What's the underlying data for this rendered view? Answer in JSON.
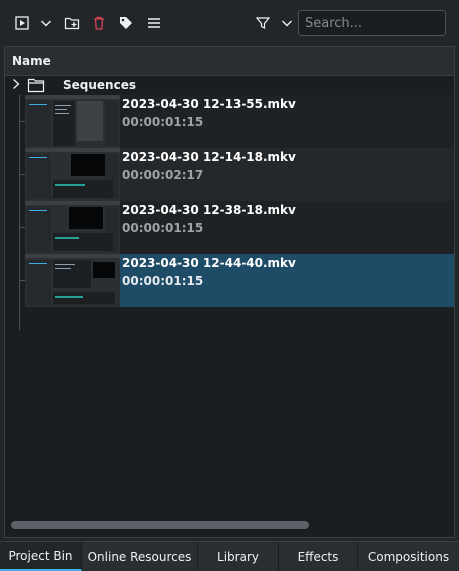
{
  "toolbar": {
    "icons": [
      "add-clip-icon",
      "chevron-down-icon",
      "new-folder-icon",
      "delete-icon",
      "tag-icon",
      "menu-icon",
      "filter-icon",
      "chevron-down-icon"
    ],
    "search_placeholder": "Search..."
  },
  "columns": {
    "name_header": "Name"
  },
  "tree": {
    "folder": {
      "label": "Sequences"
    },
    "clips": [
      {
        "name": "2023-04-30 12-13-55.mkv",
        "duration": "00:00:01:15",
        "selected": false
      },
      {
        "name": "2023-04-30 12-14-18.mkv",
        "duration": "00:00:02:17",
        "selected": false
      },
      {
        "name": "2023-04-30 12-38-18.mkv",
        "duration": "00:00:01:15",
        "selected": false
      },
      {
        "name": "2023-04-30 12-44-40.mkv",
        "duration": "00:00:01:15",
        "selected": true
      }
    ]
  },
  "tabs": [
    {
      "label": "Project Bin",
      "active": true
    },
    {
      "label": "Online Resources",
      "active": false
    },
    {
      "label": "Library",
      "active": false
    },
    {
      "label": "Effects",
      "active": false
    },
    {
      "label": "Compositions",
      "active": false
    }
  ],
  "colors": {
    "background": "#232629",
    "panel": "#1b1e20",
    "selection": "#1e4b66",
    "accent": "#3daee9",
    "delete": "#da4453"
  }
}
